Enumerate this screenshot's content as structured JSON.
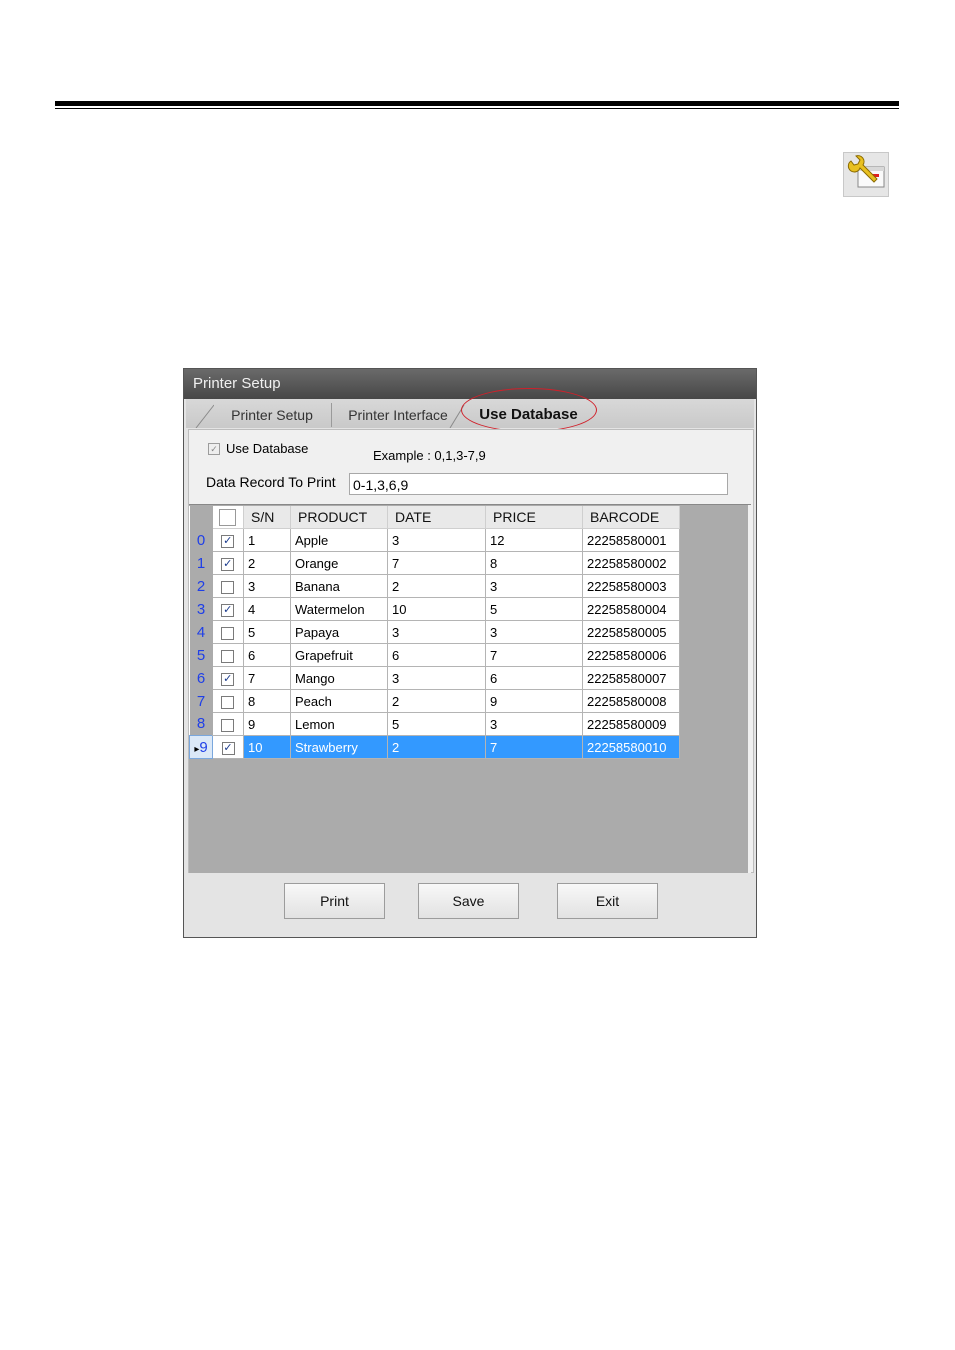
{
  "dialog": {
    "title": "Printer Setup",
    "tabs": [
      {
        "label": "Printer Setup",
        "active": false
      },
      {
        "label": "Printer Interface",
        "active": false
      },
      {
        "label": "Use Database",
        "active": true
      }
    ],
    "use_database": {
      "label": "Use Database",
      "checked": true
    },
    "example_text": "Example : 0,1,3-7,9",
    "record_label": "Data Record To Print",
    "record_value": "0-1,3,6,9",
    "table": {
      "columns": [
        "S/N",
        "PRODUCT",
        "DATE",
        "PRICE",
        "BARCODE"
      ],
      "rows": [
        {
          "index": "0",
          "checked": true,
          "sn": "1",
          "product": "Apple",
          "date": "3",
          "price": "12",
          "barcode": "22258580001"
        },
        {
          "index": "1",
          "checked": true,
          "sn": "2",
          "product": "Orange",
          "date": "7",
          "price": "8",
          "barcode": "22258580002"
        },
        {
          "index": "2",
          "checked": false,
          "sn": "3",
          "product": "Banana",
          "date": "2",
          "price": "3",
          "barcode": "22258580003"
        },
        {
          "index": "3",
          "checked": true,
          "sn": "4",
          "product": "Watermelon",
          "date": "10",
          "price": "5",
          "barcode": "22258580004"
        },
        {
          "index": "4",
          "checked": false,
          "sn": "5",
          "product": "Papaya",
          "date": "3",
          "price": "3",
          "barcode": "22258580005"
        },
        {
          "index": "5",
          "checked": false,
          "sn": "6",
          "product": "Grapefruit",
          "date": "6",
          "price": "7",
          "barcode": "22258580006"
        },
        {
          "index": "6",
          "checked": true,
          "sn": "7",
          "product": "Mango",
          "date": "3",
          "price": "6",
          "barcode": "22258580007"
        },
        {
          "index": "7",
          "checked": false,
          "sn": "8",
          "product": "Peach",
          "date": "2",
          "price": "9",
          "barcode": "22258580008"
        },
        {
          "index": "8",
          "checked": false,
          "sn": "9",
          "product": "Lemon",
          "date": "5",
          "price": "3",
          "barcode": "22258580009"
        },
        {
          "index": "9",
          "checked": true,
          "sn": "10",
          "product": "Strawberry",
          "date": "2",
          "price": "7",
          "barcode": "22258580010",
          "selected": true
        }
      ]
    },
    "buttons": {
      "print": "Print",
      "save": "Save",
      "exit": "Exit"
    }
  },
  "icons": {
    "settings": "tool-settings-icon"
  },
  "colors": {
    "selection": "#3399ff",
    "row_index": "#1f3fe8",
    "highlight_ring": "#d0202a"
  }
}
